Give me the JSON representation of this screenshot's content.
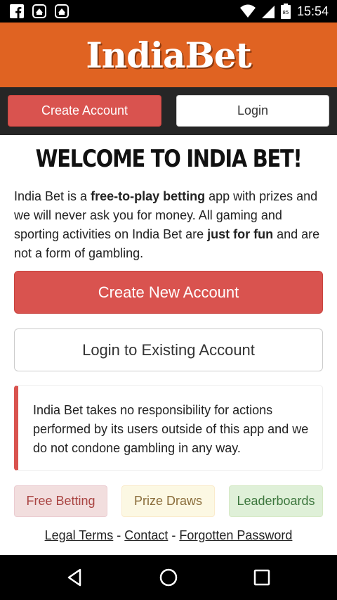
{
  "status_bar": {
    "time": "15:54",
    "left_icons": [
      "facebook-icon",
      "notification-app-icon",
      "notification-app-icon"
    ],
    "right_icons": [
      "wifi-icon",
      "signal-icon",
      "battery-icon"
    ],
    "battery_level": "85"
  },
  "header": {
    "logo_text": "IndiaBet"
  },
  "nav": {
    "create_account": "Create Account",
    "login": "Login"
  },
  "main": {
    "title": "WELCOME TO INDIA BET!",
    "intro": {
      "p1": "India Bet is a ",
      "b1": "free-to-play betting",
      "p2": " app with prizes and we will never ask you for money. All gaming and sporting activities on India Bet are ",
      "b2": "just for fun",
      "p3": " and are not a form of gambling."
    },
    "create_new_account": "Create New Account",
    "login_existing": "Login to Existing Account",
    "notice": "India Bet takes no responsibility for actions performed by its users outside of this app and we do not condone gambling in any way.",
    "tags": {
      "free_betting": "Free Betting",
      "prize_draws": "Prize Draws",
      "leaderboards": "Leaderboards"
    },
    "footer": {
      "legal_terms": "Legal Terms",
      "contact": "Contact",
      "forgotten_password": "Forgotten Password",
      "separator": " - "
    }
  },
  "colors": {
    "brand_orange": "#e06322",
    "primary_red": "#d9534f",
    "nav_dark": "#262626"
  }
}
